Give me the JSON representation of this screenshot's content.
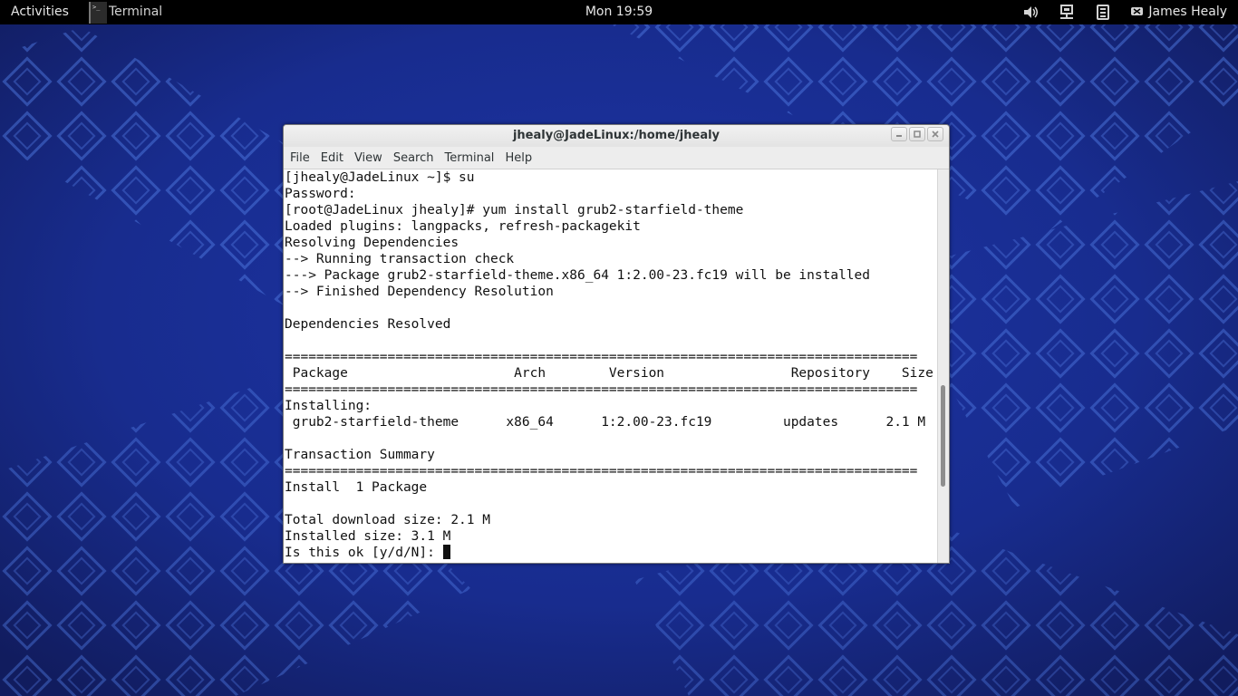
{
  "top_bar": {
    "activities_label": "Activities",
    "app_menu_label": "Terminal",
    "clock": "Mon 19:59",
    "status_icons": [
      "volume-icon",
      "network-icon",
      "battery-icon"
    ],
    "user_name": "James Healy"
  },
  "window": {
    "title": "jhealy@JadeLinux:/home/jhealy",
    "controls": {
      "minimize_icon": "minimize-icon",
      "maximize_icon": "maximize-icon",
      "close_icon": "close-icon"
    }
  },
  "menubar": {
    "items": [
      "File",
      "Edit",
      "View",
      "Search",
      "Terminal",
      "Help"
    ]
  },
  "terminal": {
    "lines": [
      "[jhealy@JadeLinux ~]$ su",
      "Password:",
      "[root@JadeLinux jhealy]# yum install grub2-starfield-theme",
      "Loaded plugins: langpacks, refresh-packagekit",
      "Resolving Dependencies",
      "--> Running transaction check",
      "---> Package grub2-starfield-theme.x86_64 1:2.00-23.fc19 will be installed",
      "--> Finished Dependency Resolution",
      "",
      "Dependencies Resolved",
      "",
      "================================================================================",
      " Package                     Arch        Version                Repository    Size",
      "================================================================================",
      "Installing:",
      " grub2-starfield-theme      x86_64      1:2.00-23.fc19         updates      2.1 M",
      "",
      "Transaction Summary",
      "================================================================================",
      "Install  1 Package",
      "",
      "Total download size: 2.1 M",
      "Installed size: 3.1 M",
      "Is this ok [y/d/N]: "
    ],
    "scroll_position_fraction": 0.74,
    "scroll_thumb_fraction": 0.26
  },
  "colors": {
    "wallpaper_base": "#16257e",
    "wallpaper_pattern": "#3a5fc8",
    "top_bar": "#000000",
    "terminal_bg": "#ffffff",
    "terminal_fg": "#111111"
  }
}
